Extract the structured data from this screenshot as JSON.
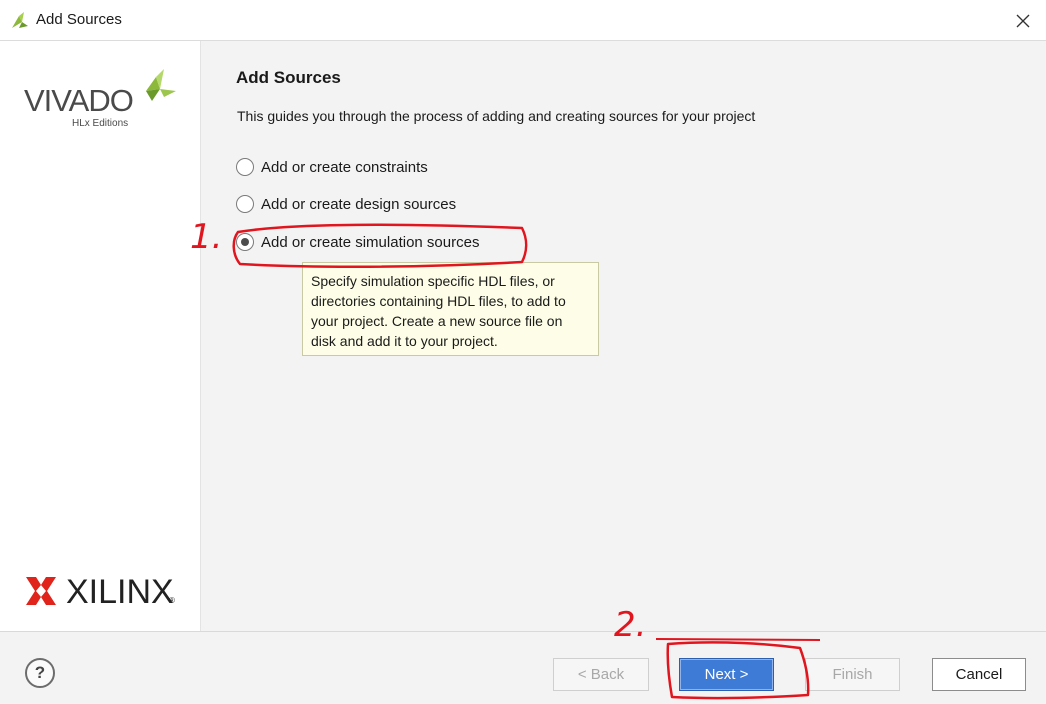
{
  "window": {
    "title": "Add Sources",
    "app_icon": "vivado-leaf-icon",
    "close_icon": "close-icon"
  },
  "sidebar": {
    "brand": "VIVADO",
    "brand_sub": "HLx Editions",
    "vendor": "XILINX",
    "vendor_mark": "®"
  },
  "main": {
    "heading": "Add Sources",
    "description": "This guides you through the process of adding and creating sources for your project",
    "options": [
      {
        "label": "Add or create constraints",
        "checked": false
      },
      {
        "label": "Add or create design sources",
        "checked": false
      },
      {
        "label": "Add or create simulation sources",
        "checked": true
      }
    ],
    "tooltip": "Specify simulation specific HDL files, or directories containing HDL files, to add to your project. Create a new source file on disk and add it to your project."
  },
  "footer": {
    "help": "?",
    "back": "< Back",
    "next": "Next >",
    "finish": "Finish",
    "cancel": "Cancel"
  },
  "annotations": {
    "marker_1": "1.",
    "marker_2": "2."
  },
  "colors": {
    "accent": "#3e7bd6",
    "annotation": "#e0151e",
    "brand_green": "#8cb83c"
  }
}
